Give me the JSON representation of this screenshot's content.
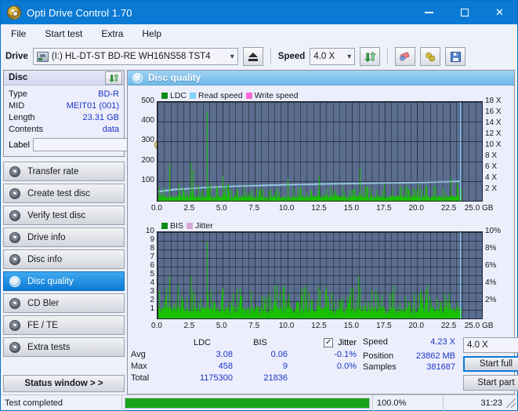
{
  "window": {
    "title": "Opti Drive Control 1.70",
    "icon": "disc-icon",
    "minimize": "–",
    "maximize": "□",
    "close": "✕"
  },
  "menubar": {
    "items": [
      "File",
      "Start test",
      "Extra",
      "Help"
    ]
  },
  "toolbar": {
    "drive_label": "Drive",
    "drive_value": "(I:)  HL-DT-ST BD-RE  WH16NS58 TST4",
    "eject_title": "Eject",
    "speed_label": "Speed",
    "speed_value": "4.0 X",
    "refresh_icon": "refresh-icon",
    "erase_icon": "eraser-icon",
    "settings_icon": "bolts-icon",
    "save_icon": "save-icon",
    "chevron": "⌄"
  },
  "disc_panel": {
    "title": "Disc",
    "refresh_icon": "refresh-icon",
    "rows": [
      {
        "key": "Type",
        "value": "BD-R"
      },
      {
        "key": "MID",
        "value": "MEIT01 (001)"
      },
      {
        "key": "Length",
        "value": "23.31 GB"
      },
      {
        "key": "Contents",
        "value": "data"
      }
    ],
    "label_key": "Label",
    "label_value": "",
    "label_placeholder": "",
    "disc_button_icon": "cd-icon"
  },
  "sidebar": {
    "items": [
      {
        "label": "Transfer rate",
        "active": false
      },
      {
        "label": "Create test disc",
        "active": false
      },
      {
        "label": "Verify test disc",
        "active": false
      },
      {
        "label": "Drive info",
        "active": false
      },
      {
        "label": "Disc info",
        "active": false
      },
      {
        "label": "Disc quality",
        "active": true
      },
      {
        "label": "CD Bler",
        "active": false
      },
      {
        "label": "FE / TE",
        "active": false
      },
      {
        "label": "Extra tests",
        "active": false
      }
    ],
    "status_window": "Status window > >"
  },
  "main": {
    "header_title": "Disc quality",
    "header_icon": "disc-quality-icon"
  },
  "chart_data": [
    {
      "type": "line",
      "name": "disc-quality-ldc",
      "title": "",
      "xlabel": "GB",
      "ylabel": "",
      "legend": [
        {
          "label": "LDC",
          "color": "#0a8a16"
        },
        {
          "label": "Read speed",
          "color": "#7fd4f7"
        },
        {
          "label": "Write speed",
          "color": "#ff66d9"
        }
      ],
      "legend_position": "top-left",
      "grid": true,
      "xlim": [
        0.0,
        25.0
      ],
      "xticks": [
        0.0,
        2.5,
        5.0,
        7.5,
        10.0,
        12.5,
        15.0,
        17.5,
        20.0,
        22.5,
        25.0
      ],
      "xtick_labels": [
        "0.0",
        "2.5",
        "5.0",
        "7.5",
        "10.0",
        "12.5",
        "15.0",
        "17.5",
        "20.0",
        "22.5",
        "25.0 GB"
      ],
      "ylim": [
        0,
        500
      ],
      "yticks": [
        100,
        200,
        300,
        400,
        500
      ],
      "ytick_labels": [
        "100",
        "200",
        "300",
        "400",
        "500"
      ],
      "y2lim": [
        0,
        18
      ],
      "y2ticks": [
        2,
        4,
        6,
        8,
        10,
        12,
        14,
        16,
        18
      ],
      "y2tick_labels": [
        "2 X",
        "4 X",
        "6 X",
        "8 X",
        "10 X",
        "12 X",
        "14 X",
        "16 X",
        "18 X"
      ],
      "marker_x": 23.3,
      "series": [
        {
          "name": "Read speed",
          "color": "#a5ddf7",
          "axis": "y2",
          "x": [
            0.0,
            1.2,
            2.6,
            4.0,
            5.4,
            6.8,
            8.2,
            9.6,
            11.0,
            12.4,
            13.8,
            15.2,
            16.6,
            18.0,
            19.4,
            20.8,
            22.2,
            23.3
          ],
          "values": [
            1.8,
            2.2,
            2.4,
            2.6,
            2.75,
            2.85,
            2.95,
            3.05,
            3.1,
            3.2,
            3.25,
            3.3,
            3.35,
            3.4,
            3.45,
            3.5,
            3.6,
            3.7
          ]
        },
        {
          "name": "LDC",
          "color": "#18c000",
          "axis": "y1",
          "baseline": 20,
          "peaks": [
            {
              "x": 0.85,
              "y": 190
            },
            {
              "x": 1.55,
              "y": 95
            },
            {
              "x": 2.45,
              "y": 197
            },
            {
              "x": 2.65,
              "y": 160
            },
            {
              "x": 3.05,
              "y": 80
            },
            {
              "x": 3.75,
              "y": 457
            },
            {
              "x": 4.0,
              "y": 95
            },
            {
              "x": 4.45,
              "y": 70
            },
            {
              "x": 4.95,
              "y": 133
            },
            {
              "x": 5.35,
              "y": 92
            },
            {
              "x": 5.6,
              "y": 60
            },
            {
              "x": 6.1,
              "y": 55
            },
            {
              "x": 7.0,
              "y": 48
            },
            {
              "x": 7.8,
              "y": 62
            },
            {
              "x": 8.5,
              "y": 58
            },
            {
              "x": 9.3,
              "y": 50
            },
            {
              "x": 9.95,
              "y": 118
            },
            {
              "x": 10.4,
              "y": 70
            },
            {
              "x": 11.0,
              "y": 60
            },
            {
              "x": 11.7,
              "y": 52
            },
            {
              "x": 12.35,
              "y": 128
            },
            {
              "x": 12.9,
              "y": 66
            },
            {
              "x": 13.6,
              "y": 58
            },
            {
              "x": 14.2,
              "y": 74
            },
            {
              "x": 14.9,
              "y": 62
            },
            {
              "x": 15.5,
              "y": 176
            },
            {
              "x": 16.1,
              "y": 70
            },
            {
              "x": 16.8,
              "y": 58
            },
            {
              "x": 17.4,
              "y": 90
            },
            {
              "x": 18.0,
              "y": 66
            },
            {
              "x": 18.7,
              "y": 72
            },
            {
              "x": 19.3,
              "y": 58
            },
            {
              "x": 20.0,
              "y": 88
            },
            {
              "x": 20.6,
              "y": 64
            },
            {
              "x": 21.2,
              "y": 78
            },
            {
              "x": 21.9,
              "y": 70
            },
            {
              "x": 22.5,
              "y": 120
            },
            {
              "x": 23.0,
              "y": 95
            }
          ]
        }
      ]
    },
    {
      "type": "line",
      "name": "disc-quality-bis",
      "title": "",
      "xlabel": "GB",
      "ylabel": "",
      "legend": [
        {
          "label": "BIS",
          "color": "#0a8a16"
        },
        {
          "label": "Jitter",
          "color": "#d9a8d9"
        }
      ],
      "legend_position": "top-left",
      "grid": true,
      "xlim": [
        0.0,
        25.0
      ],
      "xticks": [
        0.0,
        2.5,
        5.0,
        7.5,
        10.0,
        12.5,
        15.0,
        17.5,
        20.0,
        22.5,
        25.0
      ],
      "xtick_labels": [
        "0.0",
        "2.5",
        "5.0",
        "7.5",
        "10.0",
        "12.5",
        "15.0",
        "17.5",
        "20.0",
        "22.5",
        "25.0 GB"
      ],
      "ylim": [
        0,
        10
      ],
      "yticks": [
        1,
        2,
        3,
        4,
        5,
        6,
        7,
        8,
        9,
        10
      ],
      "ytick_labels": [
        "1",
        "2",
        "3",
        "4",
        "5",
        "6",
        "7",
        "8",
        "9",
        "10"
      ],
      "y2lim": [
        0,
        10
      ],
      "y2ticks": [
        2,
        4,
        6,
        8,
        10
      ],
      "y2tick_labels": [
        "2%",
        "4%",
        "6%",
        "8%",
        "10%"
      ],
      "marker_x": 23.3,
      "series": [
        {
          "name": "BIS",
          "color": "#18c000",
          "axis": "y1",
          "baseline": 1.0,
          "peaks": [
            {
              "x": 0.85,
              "y": 5
            },
            {
              "x": 1.3,
              "y": 2
            },
            {
              "x": 1.75,
              "y": 2
            },
            {
              "x": 2.45,
              "y": 5
            },
            {
              "x": 2.75,
              "y": 3
            },
            {
              "x": 3.1,
              "y": 2
            },
            {
              "x": 3.75,
              "y": 9
            },
            {
              "x": 4.2,
              "y": 2
            },
            {
              "x": 4.95,
              "y": 3
            },
            {
              "x": 5.4,
              "y": 2
            },
            {
              "x": 6.2,
              "y": 2
            },
            {
              "x": 7.1,
              "y": 2
            },
            {
              "x": 8.0,
              "y": 2
            },
            {
              "x": 8.9,
              "y": 2
            },
            {
              "x": 9.9,
              "y": 2
            },
            {
              "x": 10.6,
              "y": 2
            },
            {
              "x": 11.4,
              "y": 2
            },
            {
              "x": 12.3,
              "y": 3
            },
            {
              "x": 13.1,
              "y": 2
            },
            {
              "x": 14.0,
              "y": 2
            },
            {
              "x": 14.8,
              "y": 2
            },
            {
              "x": 15.4,
              "y": 5
            },
            {
              "x": 16.2,
              "y": 2
            },
            {
              "x": 17.0,
              "y": 2
            },
            {
              "x": 17.8,
              "y": 3
            },
            {
              "x": 18.6,
              "y": 2
            },
            {
              "x": 19.4,
              "y": 2
            },
            {
              "x": 20.2,
              "y": 3
            },
            {
              "x": 21.0,
              "y": 2
            },
            {
              "x": 21.8,
              "y": 2
            },
            {
              "x": 22.4,
              "y": 3
            },
            {
              "x": 23.0,
              "y": 2
            }
          ]
        }
      ]
    }
  ],
  "stats": {
    "columns": [
      "LDC",
      "BIS"
    ],
    "jitter_label": "Jitter",
    "jitter_checked": true,
    "rows": [
      {
        "label": "Avg",
        "ldc": "3.08",
        "bis": "0.06",
        "jitter": "-0.1%"
      },
      {
        "label": "Max",
        "ldc": "458",
        "bis": "9",
        "jitter": "0.0%"
      },
      {
        "label": "Total",
        "ldc": "1175300",
        "bis": "21836",
        "jitter": ""
      }
    ]
  },
  "results": {
    "speed_label": "Speed",
    "speed_value": "4.23 X",
    "position_label": "Position",
    "position_value": "23862 MB",
    "samples_label": "Samples",
    "samples_value": "381687",
    "speed_select": "4.0 X",
    "start_full": "Start full",
    "start_part": "Start part"
  },
  "statusbar": {
    "status": "Test completed",
    "progress_percent": 100.0,
    "progress_text": "100.0%",
    "elapsed": "31:23"
  },
  "colors": {
    "accent": "#0b7ad4",
    "plot_bg": "#5a6d8f",
    "grid": "#2d3647",
    "ldc_green": "#18c000",
    "read_speed": "#a5ddf7",
    "write_speed": "#ff66d9",
    "jitter": "#d9a8d9",
    "value_blue": "#1b35c8",
    "progress_green": "#17a317"
  }
}
